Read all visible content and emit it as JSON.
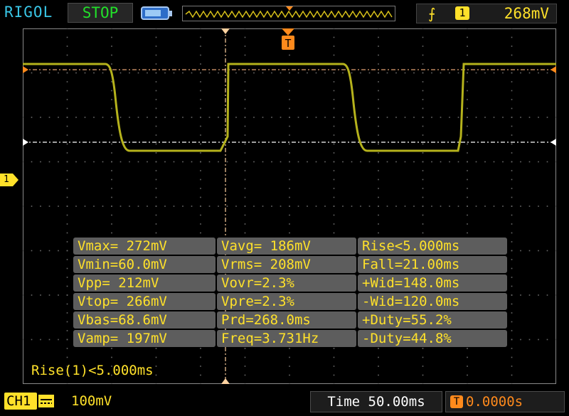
{
  "topbar": {
    "brand": "RIGOL",
    "run_state": "STOP",
    "trigger_channel": "1",
    "trigger_level": "268mV"
  },
  "screen": {
    "channel_marker": "1",
    "trigger_tag": "T",
    "trace_color": "#b5b21c"
  },
  "measurements": {
    "rows": [
      [
        "Vmax= 272mV",
        "Vavg= 186mV",
        "Rise<5.000ms"
      ],
      [
        "Vmin=60.0mV",
        "Vrms= 208mV",
        "Fall=21.00ms"
      ],
      [
        "Vpp= 212mV",
        "Vovr=2.3%",
        "+Wid=148.0ms"
      ],
      [
        "Vtop= 266mV",
        "Vpre=2.3%",
        "-Wid=120.0ms"
      ],
      [
        "Vbas=68.6mV",
        "Prd=268.0ms",
        "+Duty=55.2%"
      ],
      [
        "Vamp= 197mV",
        "Freq=3.731Hz",
        "-Duty=44.8%"
      ]
    ]
  },
  "status_line": "Rise(1)<5.000ms",
  "bottombar": {
    "channel": "CH1",
    "scale": "100mV",
    "timebase": "Time 50.00ms",
    "trigger_badge": "T",
    "trigger_delay": "0.0000s"
  }
}
